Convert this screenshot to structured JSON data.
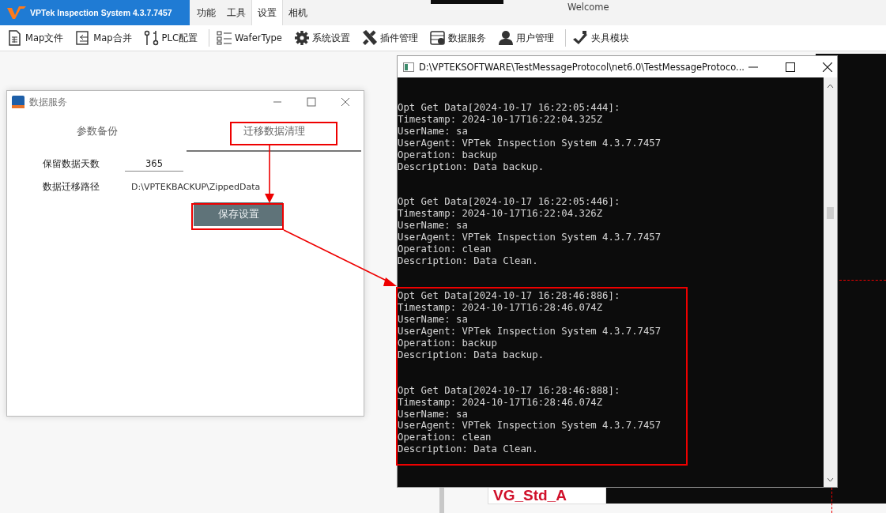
{
  "app": {
    "title": "VPTek Inspection System 4.3.7.7457",
    "welcome": "Welcome",
    "menu": [
      {
        "label": "功能",
        "selected": false
      },
      {
        "label": "工具",
        "selected": false
      },
      {
        "label": "设置",
        "selected": true
      },
      {
        "label": "相机",
        "selected": false
      }
    ]
  },
  "toolbar": [
    {
      "label": "Map文件",
      "separator_after": false
    },
    {
      "label": "Map合并",
      "separator_after": false
    },
    {
      "label": "PLC配置",
      "separator_after": true
    },
    {
      "label": "WaferType",
      "separator_after": false
    },
    {
      "label": "系统设置",
      "separator_after": false
    },
    {
      "label": "插件管理",
      "separator_after": false
    },
    {
      "label": "数据服务",
      "separator_after": false
    },
    {
      "label": "用户管理",
      "separator_after": true
    },
    {
      "label": "夹具模块",
      "separator_after": false
    }
  ],
  "dialog": {
    "title": "数据服务",
    "tabs": [
      {
        "label": "参数备份",
        "selected": false
      },
      {
        "label": "迁移数据清理",
        "selected": true
      }
    ],
    "fields": [
      {
        "label": "保留数据天数",
        "value": "365",
        "kind": "input"
      },
      {
        "label": "数据迁移路径",
        "value": "D:\\VPTEKBACKUP\\ZippedData",
        "kind": "text"
      }
    ],
    "button": "保存设置"
  },
  "console": {
    "title": "D:\\VPTEKSOFTWARE\\TestMessageProtocol\\net6.0\\TestMessageProtoco...",
    "entries": [
      {
        "lines": [
          "Opt Get Data[2024-10-17 16:22:05:444]:",
          "Timestamp: 2024-10-17T16:22:04.325Z",
          "UserName: sa",
          "UserAgent: VPTek Inspection System 4.3.7.7457",
          "Operation: backup",
          "Description: Data backup."
        ]
      },
      {
        "lines": [
          "Opt Get Data[2024-10-17 16:22:05:446]:",
          "Timestamp: 2024-10-17T16:22:04.326Z",
          "UserName: sa",
          "UserAgent: VPTek Inspection System 4.3.7.7457",
          "Operation: clean",
          "Description: Data Clean."
        ]
      },
      {
        "lines": [
          "Opt Get Data[2024-10-17 16:28:46:886]:",
          "Timestamp: 2024-10-17T16:28:46.074Z",
          "UserName: sa",
          "UserAgent: VPTek Inspection System 4.3.7.7457",
          "Operation: backup",
          "Description: Data backup."
        ]
      },
      {
        "lines": [
          "Opt Get Data[2024-10-17 16:28:46:888]:",
          "Timestamp: 2024-10-17T16:28:46.074Z",
          "UserName: sa",
          "UserAgent: VPTek Inspection System 4.3.7.7457",
          "Operation: clean",
          "Description: Data Clean."
        ]
      }
    ]
  },
  "canvas": {
    "label": "VG_Std_A"
  }
}
